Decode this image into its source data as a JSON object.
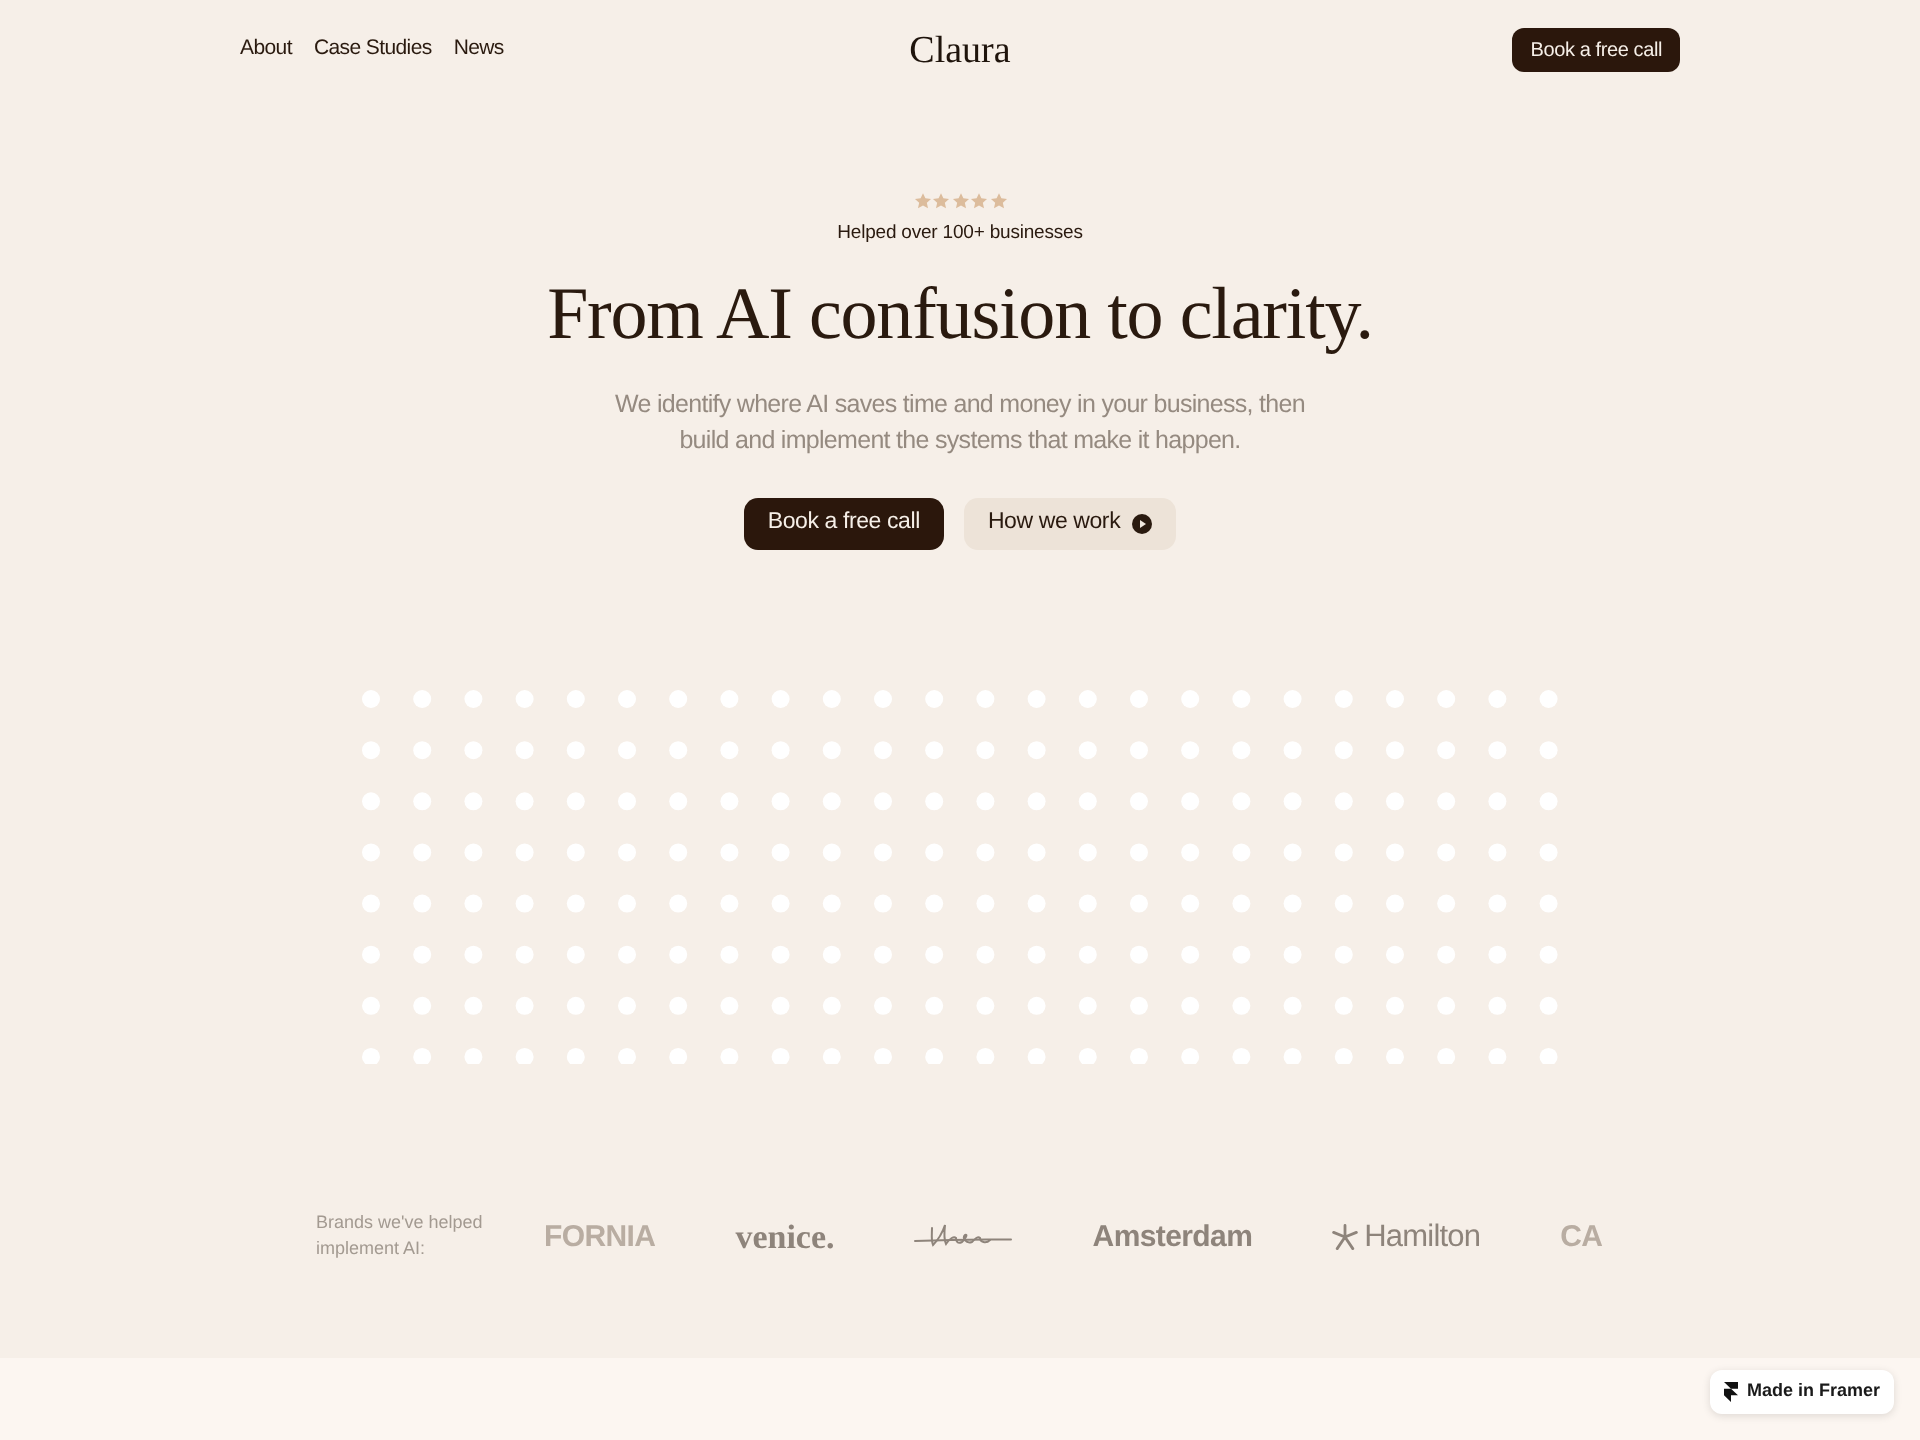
{
  "nav": {
    "links": [
      {
        "label": "About"
      },
      {
        "label": "Case Studies"
      },
      {
        "label": "News"
      }
    ],
    "logo": "Claura",
    "cta": "Book a free call"
  },
  "hero": {
    "stars": 5,
    "rating_caption": "Helped over 100+ businesses",
    "headline": "From AI confusion to clarity.",
    "subheadline": "We identify where AI saves time and money in your business, then build and implement the systems that make it happen.",
    "buttons": [
      {
        "label": "Book a free call",
        "kind": "primary"
      },
      {
        "label": "How we work",
        "kind": "secondary"
      }
    ]
  },
  "brands": {
    "caption": "Brands we've helped implement AI:",
    "logos": [
      {
        "kind": "sans",
        "text": "FORNIA",
        "faded": true
      },
      {
        "kind": "serif",
        "text": "venice.",
        "faded": false
      },
      {
        "kind": "script",
        "faded": false
      },
      {
        "kind": "sans",
        "text": "Amsterdam",
        "faded": false
      },
      {
        "kind": "starred",
        "text": "Hamilton",
        "faded": false
      },
      {
        "kind": "sans",
        "text": "CA",
        "faded": true
      }
    ]
  },
  "badge": {
    "label": "Made in Framer"
  }
}
